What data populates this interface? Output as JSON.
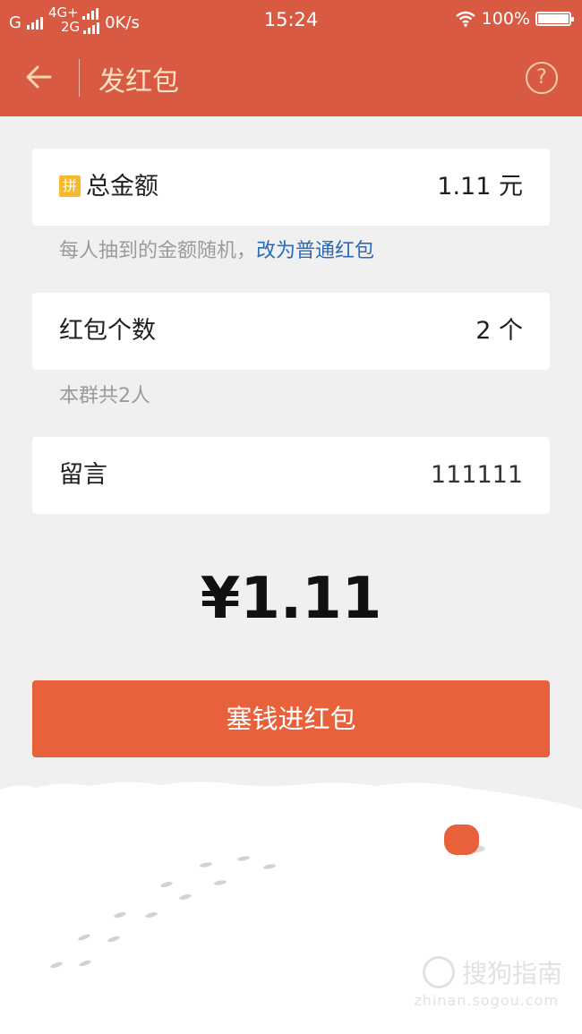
{
  "status_bar": {
    "carrier1": "G",
    "net_top": "4G+",
    "net_bottom": "2G",
    "speed": "0K/s",
    "time": "15:24",
    "battery": "100%"
  },
  "nav": {
    "title": "发红包",
    "help": "?"
  },
  "total_amount": {
    "badge": "拼",
    "label": "总金额",
    "value": "1.11  元",
    "hint": "每人抽到的金额随机，",
    "hint_link": "改为普通红包"
  },
  "count": {
    "label": "红包个数",
    "value": "2  个",
    "hint": "本群共2人"
  },
  "message": {
    "label": "留言",
    "value": "111111"
  },
  "display_amount": "¥1.11",
  "send_button": "塞钱进红包",
  "watermark": {
    "text": "搜狗指南",
    "url": "zhinan.sogou.com"
  },
  "colors": {
    "header": "#d85a43",
    "button": "#e8613a",
    "link": "#2b6ab4",
    "badge": "#f5b82e"
  }
}
